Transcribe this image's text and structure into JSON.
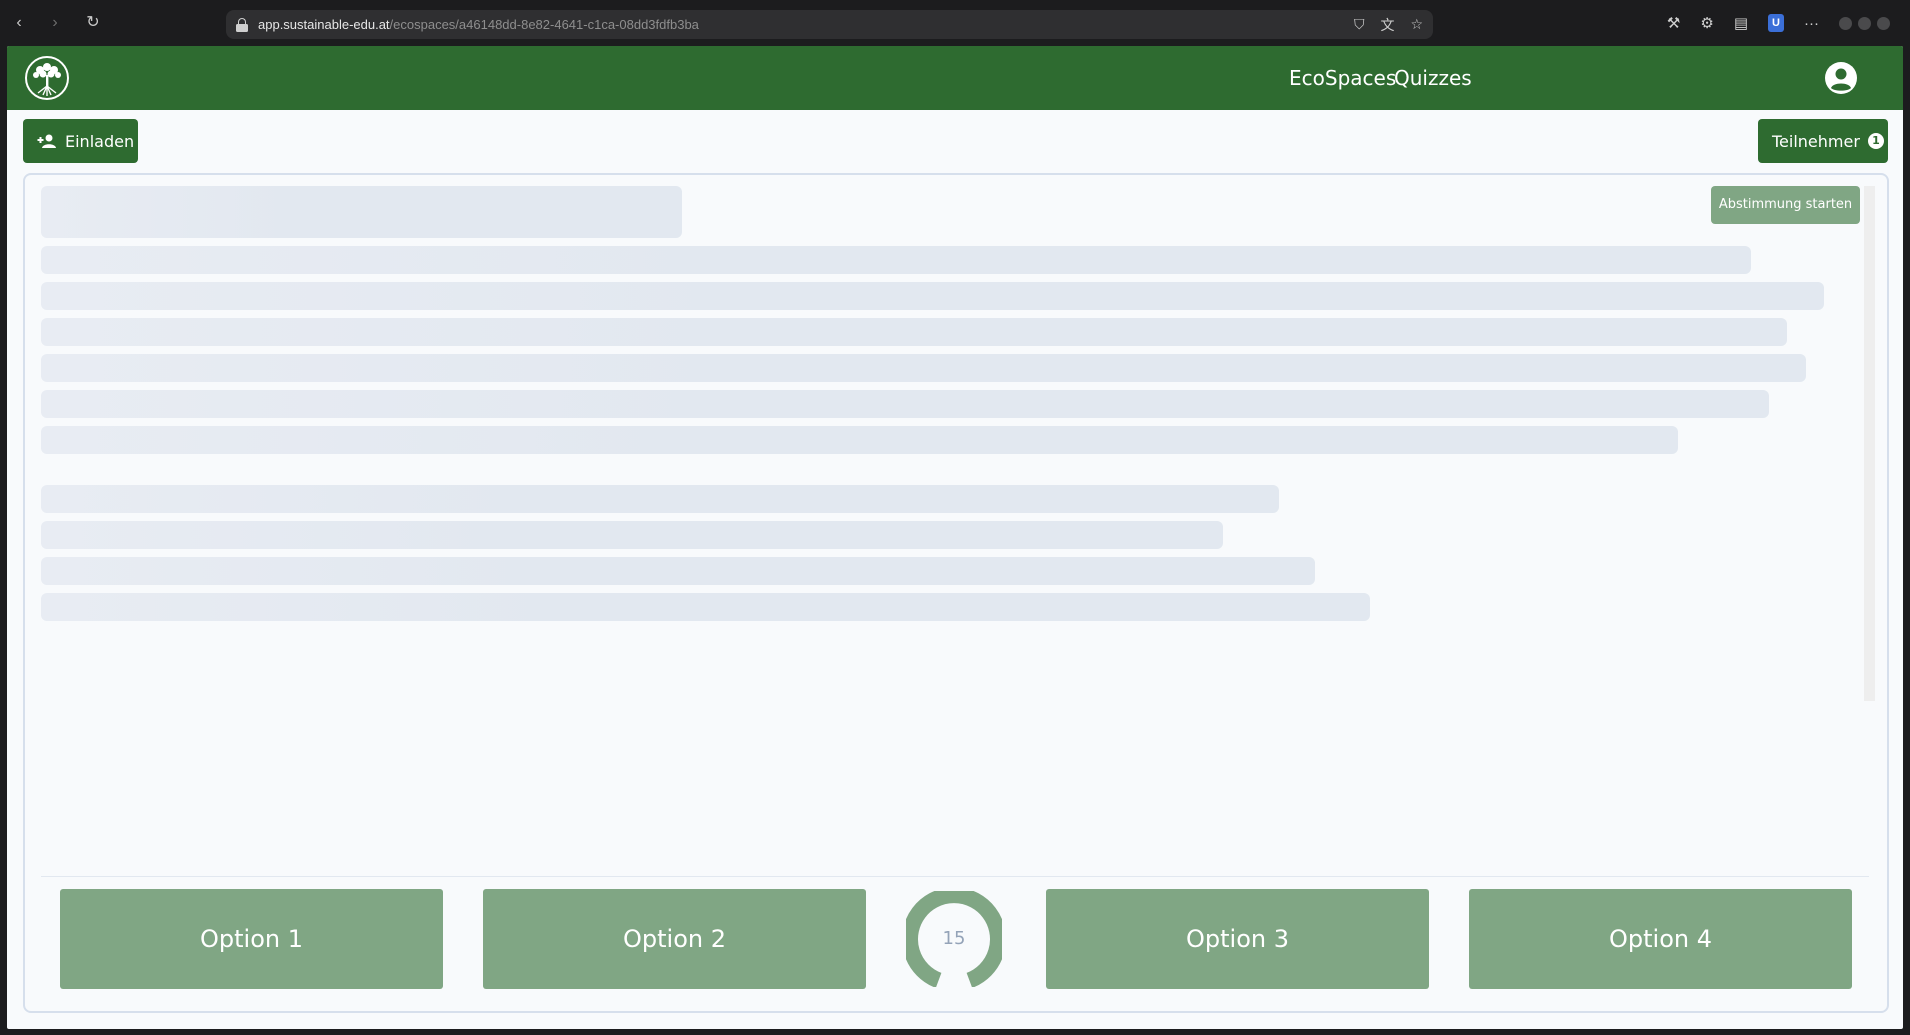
{
  "browser": {
    "url_host": "app.sustainable-edu.at",
    "url_path": "/ecospaces/a46148dd-8e82-4641-c1ca-08dd3fdfb3ba",
    "ext_badge": "U",
    "more": "···"
  },
  "header": {
    "nav": [
      "EcoSpaces",
      "Quizzes"
    ]
  },
  "toolbar": {
    "invite_label": "Einladen",
    "participants_label": "Teilnehmer",
    "participants_count": "1"
  },
  "card": {
    "start_vote_label": "Abstimmung starten"
  },
  "voting": {
    "options": [
      "Option 1",
      "Option 2",
      "Option 3",
      "Option 4"
    ],
    "timer": "15"
  },
  "colors": {
    "brand_green": "#2e6b30",
    "option_green": "#80a684",
    "skeleton": "#e2e8f0"
  }
}
